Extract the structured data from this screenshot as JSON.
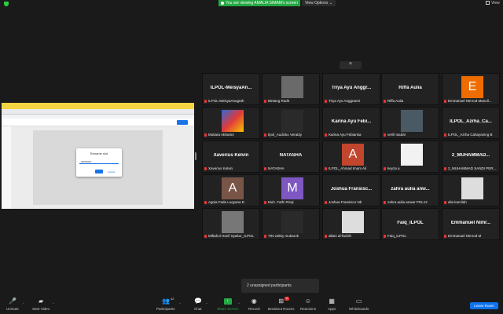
{
  "topbar": {
    "viewing": "You are viewing AMALIA SIMAM's screen",
    "view_options": "View Options",
    "view": "View"
  },
  "share": {
    "dialog_title": "Rename slot",
    "dialog_field": "00000000",
    "ok": "ok",
    "cancel": "Cancel"
  },
  "grid": {
    "up_arrow": "^",
    "tiles": [
      {
        "name": "ILPOL-MeisyaAn...",
        "label": "ILPOL-MeisyaAnugrah",
        "avatar": ""
      },
      {
        "name": "",
        "label": "Bintang Radit",
        "avatar": "photo"
      },
      {
        "name": "Triya Ayu Anggr...",
        "label": "Triya Ayu Anggraeni",
        "avatar": ""
      },
      {
        "name": "Riffa Aulia",
        "label": "Riffa Aulia",
        "avatar": ""
      },
      {
        "name": "",
        "label": "Emmanuel Nimrod Manull...",
        "avatar": "letterO",
        "letter": "E"
      },
      {
        "name": "",
        "label": "Mutiara Abharini",
        "avatar": "colorful"
      },
      {
        "name": "",
        "label": "Ilpol_Audicko Veraldy",
        "avatar": "dark"
      },
      {
        "name": "Karina Ayu Febi...",
        "label": "Karina Ayu Febianka",
        "avatar": ""
      },
      {
        "name": "",
        "label": "verill naufal",
        "avatar": "pic2"
      },
      {
        "name": "ILPOL_Azrha_Ca...",
        "label": "ILPOL_Azrha Cahayaning B",
        "avatar": ""
      },
      {
        "name": "Xaverius Kelvin",
        "label": "Xaverius Kelvin",
        "avatar": ""
      },
      {
        "name": "NATASHA",
        "label": "NATASHA",
        "avatar": ""
      },
      {
        "name": "",
        "label": "ILPOL_Ahmad Imam Ali",
        "avatar": "letterA1",
        "letter": "A"
      },
      {
        "name": "",
        "label": "keyza a",
        "avatar": "white"
      },
      {
        "name": "2_MUHAMMAD...",
        "label": "2_MUHAMMAD SANDI PER...",
        "avatar": ""
      },
      {
        "name": "",
        "label": "Agnia Fada Luqyana D",
        "avatar": "letterA2",
        "letter": "A"
      },
      {
        "name": "",
        "label": "Muh. Fathi Rizqi",
        "avatar": "letterM",
        "letter": "M"
      },
      {
        "name": "Joshua Fransisc...",
        "label": "Joshua Fransisco Nb",
        "avatar": ""
      },
      {
        "name": "zahra aulia anw...",
        "label": "zahra aulia anwar POL12",
        "avatar": ""
      },
      {
        "name": "",
        "label": "alia kamilah",
        "avatar": "sketch"
      },
      {
        "name": "",
        "label": "Miftahul Hanif Syakur_ILPOL",
        "avatar": "pic1"
      },
      {
        "name": "",
        "label": "TIN-zakky mubarok",
        "avatar": "dark"
      },
      {
        "name": "",
        "label": "allam al-fachih",
        "avatar": "sketch"
      },
      {
        "name": "Faiq_ILPOL",
        "label": "Faiq_ILPOL",
        "avatar": ""
      },
      {
        "name": "Emmanuel Nimr...",
        "label": "Emmanuel Nimrod M",
        "avatar": ""
      }
    ]
  },
  "unassigned": "2 unassigned participants",
  "toolbar": {
    "unmute": "Unmute",
    "start_video": "Start Video",
    "participants": "Participants",
    "participants_count": "42",
    "chat": "Chat",
    "share_screen": "Share Screen",
    "record": "Record",
    "breakout_rooms": "Breakout Rooms",
    "breakout_badge": "2",
    "reactions": "Reactions",
    "apps": "Apps",
    "whiteboards": "Whiteboards",
    "leave": "Leave Room"
  }
}
